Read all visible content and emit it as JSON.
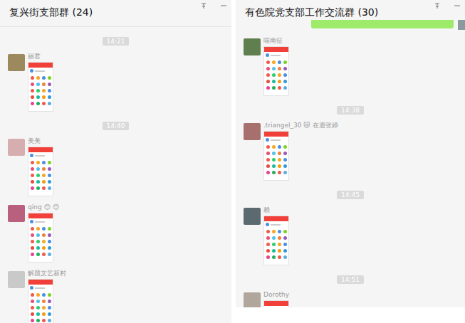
{
  "windows": [
    {
      "title": "复兴街支部群 (24)",
      "items": [
        {
          "kind": "time",
          "text": "14:21"
        },
        {
          "kind": "image",
          "sender": "丽君",
          "color": "#9c8a5e"
        },
        {
          "kind": "time",
          "text": "14:40"
        },
        {
          "kind": "image",
          "sender": "美美",
          "color": "#d7aeb0"
        },
        {
          "kind": "image",
          "sender": "qing 😊 😊",
          "color": "#b8607e"
        },
        {
          "kind": "image",
          "sender": "解题文艺新村",
          "color": "#c9c9c9"
        }
      ]
    },
    {
      "title": "有色院党支部工作交流群 (30)",
      "items": [
        {
          "kind": "sent"
        },
        {
          "kind": "image",
          "sender": "喵南征",
          "color": "#5f7f4f"
        },
        {
          "kind": "time",
          "text": "14:38"
        },
        {
          "kind": "image",
          "sender": ".triangel_30 😿 在遛张婷",
          "color": "#a8706c"
        },
        {
          "kind": "time",
          "text": "14:45"
        },
        {
          "kind": "image",
          "sender": "赖",
          "color": "#5a6a70"
        },
        {
          "kind": "time",
          "text": "14:51"
        },
        {
          "kind": "image",
          "sender": "Dorothy",
          "color": "#b0a69c"
        }
      ]
    }
  ]
}
